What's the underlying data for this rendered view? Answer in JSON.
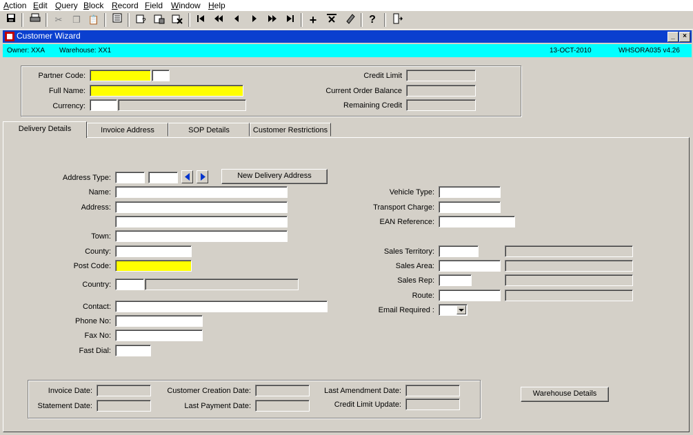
{
  "menu": [
    "Action",
    "Edit",
    "Query",
    "Block",
    "Record",
    "Field",
    "Window",
    "Help"
  ],
  "menu_accel": [
    "A",
    "E",
    "Q",
    "B",
    "R",
    "F",
    "W",
    "H"
  ],
  "window": {
    "title": "Customer Wizard"
  },
  "info": {
    "owner": "Owner:  XXA",
    "warehouse": "Warehouse:  XX1",
    "date": "13-OCT-2010",
    "version": "WHSORA035  v4.26"
  },
  "header": {
    "partner_code_label": "Partner Code:",
    "full_name_label": "Full Name:",
    "currency_label": "Currency:",
    "credit_limit_label": "Credit Limit",
    "current_order_balance_label": "Current Order Balance",
    "remaining_credit_label": "Remaining Credit"
  },
  "tabs": [
    "Delivery Details",
    "Invoice Address",
    "SOP Details",
    "Customer Restrictions"
  ],
  "delivery": {
    "address_type_label": "Address Type:",
    "new_delivery_address": "New Delivery Address",
    "name_label": "Name:",
    "address_label": "Address:",
    "town_label": "Town:",
    "county_label": "County:",
    "post_code_label": "Post Code:",
    "country_label": "Country:",
    "contact_label": "Contact:",
    "phone_label": "Phone No:",
    "fax_label": "Fax No:",
    "fast_dial_label": "Fast Dial:",
    "vehicle_type_label": "Vehicle Type:",
    "transport_charge_label": "Transport Charge:",
    "ean_reference_label": "EAN Reference:",
    "sales_territory_label": "Sales Territory:",
    "sales_area_label": "Sales Area:",
    "sales_rep_label": "Sales Rep:",
    "route_label": "Route:",
    "email_required_label": "Email Required :"
  },
  "dates": {
    "invoice_date_label": "Invoice Date:",
    "statement_date_label": "Statement Date:",
    "customer_creation_date_label": "Customer Creation Date:",
    "last_payment_date_label": "Last Payment Date:",
    "last_amendment_date_label": "Last Amendment Date:",
    "credit_limit_update_label": "Credit Limit Update:"
  },
  "warehouse_details_button": "Warehouse Details",
  "colors": {
    "title_bar": "#0a3fcf",
    "info_bar": "#00ffff",
    "mandatory_field": "#ffff00",
    "face": "#d4d0c8"
  },
  "toolbar_icons": [
    "save-icon",
    "print-icon",
    "cut-icon",
    "copy-icon",
    "paste-icon",
    "list-icon",
    "query-icon",
    "execute-query-icon",
    "cancel-query-icon",
    "first-record-icon",
    "previous-block-icon",
    "previous-record-icon",
    "next-record-icon",
    "next-block-icon",
    "last-record-icon",
    "insert-record-icon",
    "delete-record-icon",
    "clear-record-icon",
    "help-icon",
    "exit-icon"
  ]
}
